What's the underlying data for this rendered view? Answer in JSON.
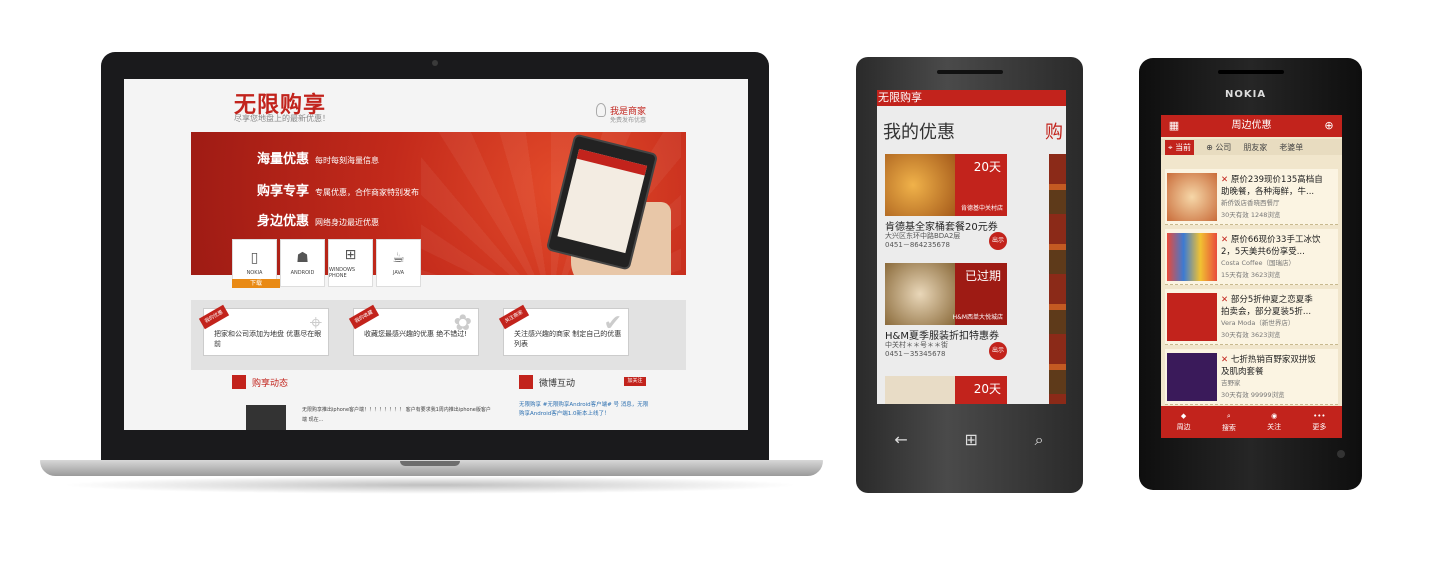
{
  "laptop": {
    "logo": "无限购享",
    "tagline": "尽享您地盘上的最新优惠！",
    "merchant_label": "我是商家",
    "merchant_sub": "免费发布优惠",
    "hero": [
      {
        "title": "海量优惠",
        "desc": "每时每刻海量信息"
      },
      {
        "title": "购享专享",
        "desc": "专属优惠，合作商家特别发布"
      },
      {
        "title": "身边优惠",
        "desc": "网络身边最近优惠"
      }
    ],
    "platforms": [
      "NOKIA",
      "ANDROID",
      "WINDOWS PHONE",
      "JAVA"
    ],
    "download_label": "下载",
    "features": [
      {
        "ribbon": "我的优惠",
        "text": "把家和公司添加为地盘 优惠尽在眼前"
      },
      {
        "ribbon": "我的收藏",
        "text": "收藏您最感兴趣的优惠 绝不错过!"
      },
      {
        "ribbon": "关注商家",
        "text": "关注感兴趣的商家 制定自己的优惠列表"
      }
    ],
    "news_title": "购享动态",
    "weibo_title": "微博互动",
    "follow_label": "加关注",
    "news_text": "无限购享推出iphone客户端！！！！！！！！ 客户有要求我1周内推出iphone版客户端 现在...",
    "weibo_text": "无限购享 #无限购享Android客户端# 号 消息，无限购享Android客户端1.0新本上线了！"
  },
  "wp": {
    "app_title": "无限购享",
    "heading": "我的优惠",
    "heading2": "购",
    "tiles": [
      {
        "label": "20天",
        "sub": "肯德基中关村店",
        "title": "肯德基全家桶套餐20元券",
        "addr1": "大兴区东环中路BDA2层",
        "addr2": "0451－864235678",
        "out": "出示"
      },
      {
        "label": "已过期",
        "sub": "H&M西单大悦城店",
        "title": "H&M夏季服装折扣特惠券",
        "addr1": "中关村＊＊号＊＊街",
        "addr2": "0451－35345678",
        "out": "出示"
      },
      {
        "label": "20天",
        "sub": "",
        "title": "",
        "addr1": "",
        "addr2": "",
        "out": ""
      }
    ],
    "nav": [
      "back-icon",
      "windows-icon",
      "search-icon"
    ]
  },
  "nokia": {
    "brand": "NOKIA",
    "title": "周边优惠",
    "tabs": [
      "当前",
      "公司",
      "朋友家",
      "老婆单"
    ],
    "items": [
      {
        "line1": "原价239现价135高档自",
        "line2": "助晚餐，各种海鲜，牛...",
        "line3": "新侨饭店香晓西餐厅",
        "stats": "30天有效      1248浏览"
      },
      {
        "line1": "原价66现价33手工冰饮",
        "line2": "2，5天美共6份享受...",
        "line3": "Costa Coffee（国瑞店）",
        "stats": "15天有效      3623浏览"
      },
      {
        "line1": "部分5折仲夏之恋夏季",
        "line2": "拍卖会，部分夏装5折...",
        "line3": "Vera Moda（新世界店）",
        "stats": "30天有效      3623浏览"
      },
      {
        "line1": "七折热销百野家双拼饭",
        "line2": "及肌肉套餐",
        "line3": "吉野家",
        "stats": "30天有效      99999浏览"
      }
    ],
    "bottom": [
      "周边",
      "搜索",
      "关注",
      "更多"
    ]
  },
  "colors": {
    "brand_red": "#c2231c",
    "download_orange": "#e98a15"
  }
}
